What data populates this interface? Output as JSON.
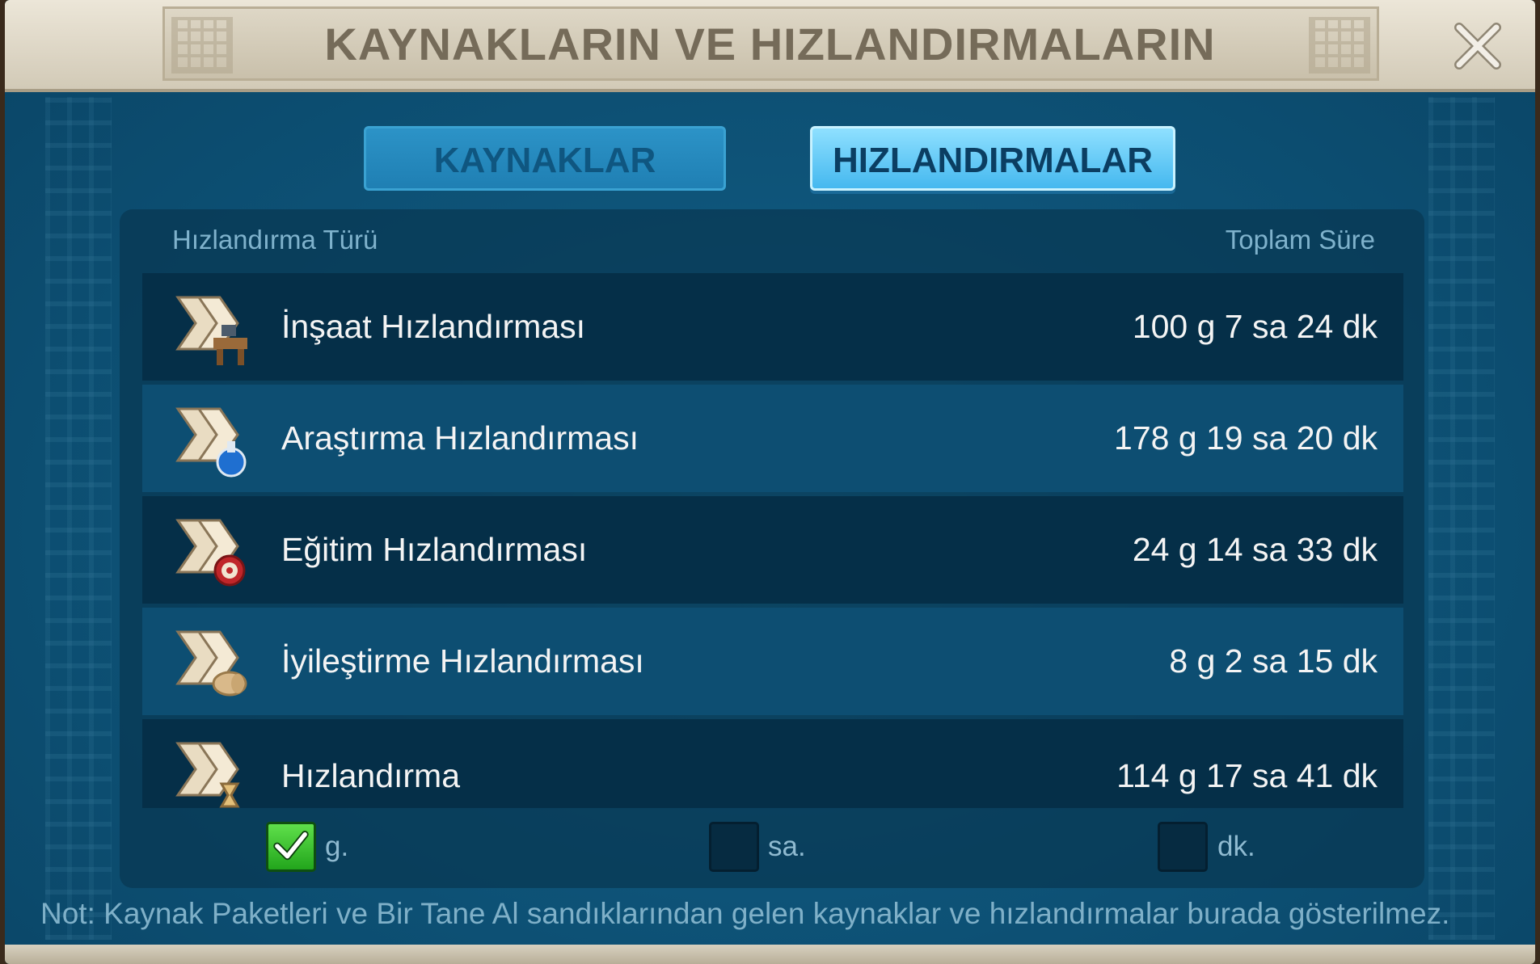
{
  "window": {
    "title": "KAYNAKLARIN VE HIZLANDIRMALARIN"
  },
  "tabs": [
    {
      "label": "KAYNAKLAR",
      "active": false
    },
    {
      "label": "HIZLANDIRMALAR",
      "active": true
    }
  ],
  "table": {
    "col_type": "Hızlandırma Türü",
    "col_total": "Toplam Süre",
    "rows": [
      {
        "name": "İnşaat Hızlandırması",
        "total": "100 g 7 sa 24 dk",
        "icon": "construction-speedup-icon"
      },
      {
        "name": "Araştırma Hızlandırması",
        "total": "178 g 19 sa 20 dk",
        "icon": "research-speedup-icon"
      },
      {
        "name": "Eğitim Hızlandırması",
        "total": "24 g 14 sa 33 dk",
        "icon": "training-speedup-icon"
      },
      {
        "name": "İyileştirme Hızlandırması",
        "total": "8 g 2 sa 15 dk",
        "icon": "healing-speedup-icon"
      },
      {
        "name": "Hızlandırma",
        "total": "114 g 17 sa 41 dk",
        "icon": "universal-speedup-icon"
      }
    ]
  },
  "filters": [
    {
      "label": "g.",
      "checked": true
    },
    {
      "label": "sa.",
      "checked": false
    },
    {
      "label": "dk.",
      "checked": false
    }
  ],
  "note": "Not: Kaynak Paketleri ve Bir Tane Al sandıklarından gelen kaynaklar ve hızlandırmalar burada gösterilmez.",
  "colors": {
    "panel_bg": "#0b4868",
    "active_tab": "#45b8ef",
    "checkbox_on": "#22a51c"
  }
}
